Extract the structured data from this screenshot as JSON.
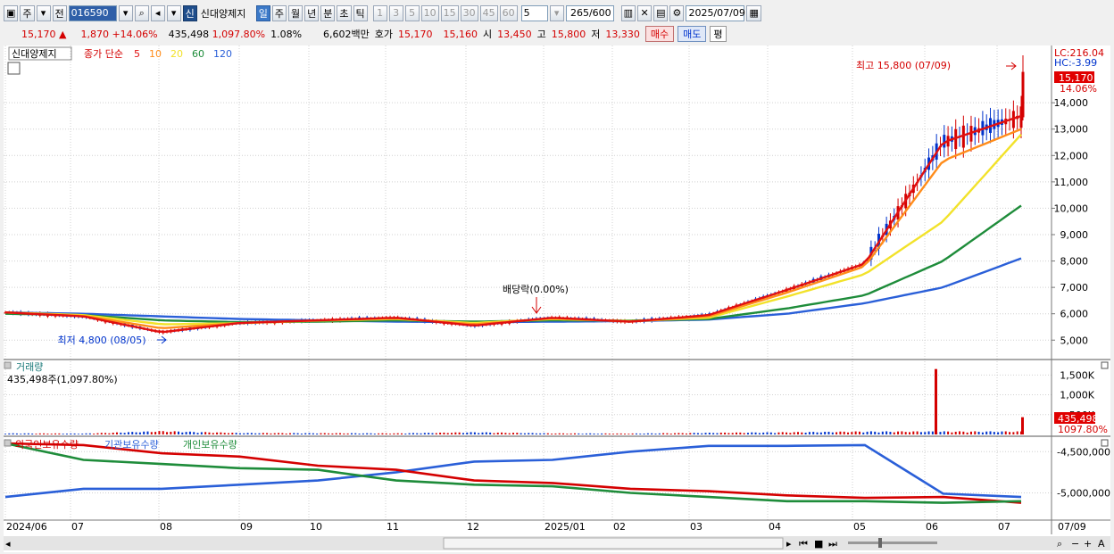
{
  "toolbar": {
    "period_toggle": "주",
    "prev_label": "전",
    "stock_code": "016590",
    "new_badge": "신",
    "stock_name": "신대양제지",
    "periods": [
      "일",
      "주",
      "월",
      "년",
      "분",
      "초",
      "틱"
    ],
    "active_period": "일",
    "intervals": [
      "1",
      "3",
      "5",
      "10",
      "15",
      "30",
      "45",
      "60"
    ],
    "interval_value": "5",
    "count": "265",
    "count_max": "/600",
    "date": "2025/07/09"
  },
  "infobar": {
    "price": "15,170",
    "arrow": "▲",
    "change": "1,870",
    "change_pct": "+14.06%",
    "volume": "435,498",
    "volume_pct": "1,097.80%",
    "turnover": "1.08%",
    "amount": "6,602백만",
    "quote_label": "호가",
    "ask": "15,170",
    "bid": "15,160",
    "open_label": "시",
    "open": "13,450",
    "high_label": "고",
    "high": "15,800",
    "low_label": "저",
    "low": "13,330",
    "buy_label": "매수",
    "sell_label": "매도",
    "avg_label": "평"
  },
  "price_panel": {
    "legend_name": "신대양제지",
    "legend_ma_label": "종가 단순",
    "ma_periods": [
      "5",
      "10",
      "20",
      "60",
      "120"
    ],
    "ma_colors": [
      "#e01010",
      "#ff8c1a",
      "#f2e22a",
      "#1e8c3a",
      "#2a5fd8"
    ],
    "lc_label": "LC:216.04",
    "hc_label": "HC:-3.99",
    "current_price": "15,170",
    "current_pct": "14.06%",
    "high_annotation": "최고 15,800 (07/09)",
    "low_annotation": "최저 4,800 (08/05)",
    "dividend_annotation": "배당락(0.00%)",
    "y_ticks": [
      "14,000",
      "13,000",
      "12,000",
      "11,000",
      "10,000",
      "9,000",
      "8,000",
      "7,000",
      "6,000",
      "5,000"
    ]
  },
  "volume_panel": {
    "title": "거래량",
    "value_text": "435,498주(1,097.80%)",
    "y_ticks": [
      "1,500K",
      "1,000K",
      "500K"
    ],
    "current_value": "435,498",
    "current_pct": "1097.80%"
  },
  "holdings_panel": {
    "legend": [
      "외국인보유수량",
      "기관보유수량",
      "개인보유수량"
    ],
    "y_ticks": [
      "-4,500,000",
      "-5,000,000"
    ]
  },
  "x_axis": {
    "labels": [
      "2024/06",
      "07",
      "08",
      "09",
      "10",
      "11",
      "12",
      "2025/01",
      "02",
      "03",
      "04",
      "05",
      "06",
      "07"
    ],
    "right_label": "07/09"
  },
  "chart_data": [
    {
      "type": "line",
      "title": "신대양제지",
      "x": [
        "2024/06",
        "07",
        "08",
        "09",
        "10",
        "11",
        "12",
        "2025/01",
        "02",
        "03",
        "04",
        "05",
        "06",
        "07/09"
      ],
      "series": [
        {
          "name": "5",
          "values": [
            6050,
            5900,
            5300,
            5650,
            5750,
            5850,
            5550,
            5850,
            5700,
            5950,
            6900,
            7900,
            12500,
            13500
          ]
        },
        {
          "name": "10",
          "values": [
            6050,
            5920,
            5450,
            5650,
            5750,
            5830,
            5600,
            5830,
            5700,
            5900,
            6800,
            7800,
            11800,
            13000
          ]
        },
        {
          "name": "20",
          "values": [
            6050,
            5950,
            5600,
            5640,
            5740,
            5800,
            5650,
            5800,
            5720,
            5850,
            6650,
            7500,
            9500,
            12800
          ]
        },
        {
          "name": "60",
          "values": [
            6000,
            5950,
            5750,
            5680,
            5700,
            5750,
            5700,
            5750,
            5740,
            5800,
            6200,
            6700,
            8000,
            10100
          ]
        },
        {
          "name": "120",
          "values": [
            6050,
            6000,
            5900,
            5800,
            5750,
            5700,
            5680,
            5700,
            5720,
            5780,
            6000,
            6400,
            7000,
            8100
          ]
        }
      ],
      "ylim": [
        4400,
        15900
      ]
    },
    {
      "type": "bar",
      "title": "거래량",
      "categories": [
        "2024/06",
        "07",
        "08",
        "09",
        "10",
        "11",
        "12",
        "2025/01",
        "02",
        "03",
        "04",
        "05",
        "06",
        "07/09"
      ],
      "values": [
        30000,
        25000,
        90000,
        40000,
        35000,
        30000,
        60000,
        30000,
        25000,
        45000,
        60000,
        80000,
        1650000,
        435498
      ],
      "ylim": [
        0,
        1800000
      ]
    },
    {
      "type": "line",
      "x": [
        "2024/06",
        "07",
        "08",
        "09",
        "10",
        "11",
        "12",
        "2025/01",
        "02",
        "03",
        "04",
        "05",
        "06",
        "07/09"
      ],
      "series": [
        {
          "name": "외국인보유수량",
          "values": [
            -5050000,
            -4950000,
            -4950000,
            -4900000,
            -4850000,
            -4750000,
            -4620000,
            -4600000,
            -4500000,
            -4430000,
            -4430000,
            -4420000,
            -5010000,
            -5050000
          ]
        },
        {
          "name": "기관보유수량",
          "values": [
            -4400000,
            -4420000,
            -4520000,
            -4560000,
            -4670000,
            -4720000,
            -4850000,
            -4880000,
            -4950000,
            -4980000,
            -5030000,
            -5060000,
            -5050000,
            -5120000
          ]
        },
        {
          "name": "개인보유수량",
          "values": [
            -4400000,
            -4600000,
            -4650000,
            -4700000,
            -4720000,
            -4850000,
            -4900000,
            -4920000,
            -5000000,
            -5050000,
            -5100000,
            -5100000,
            -5120000,
            -5100000
          ]
        }
      ]
    }
  ]
}
